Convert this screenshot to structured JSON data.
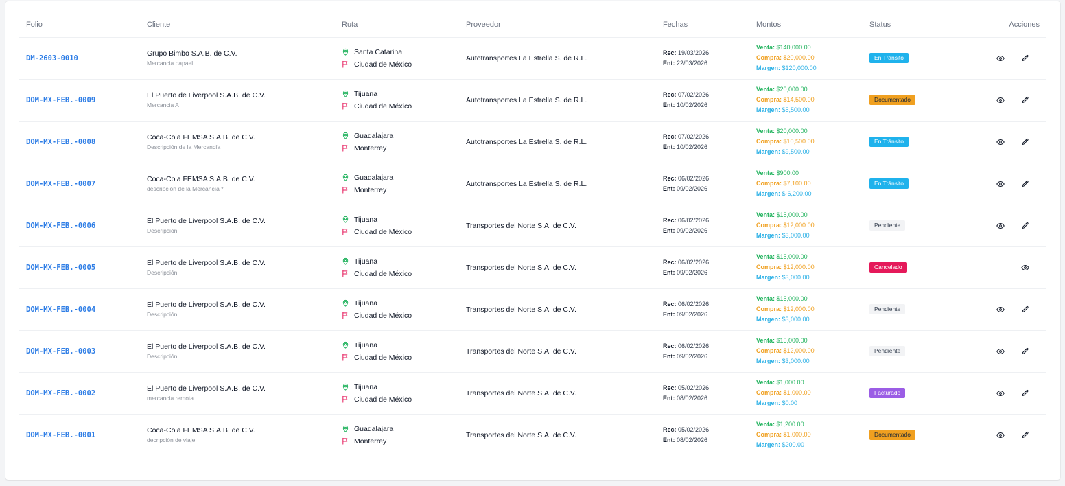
{
  "headers": {
    "folio": "Folio",
    "cliente": "Cliente",
    "ruta": "Ruta",
    "proveedor": "Proveedor",
    "fechas": "Fechas",
    "montos": "Montos",
    "status": "Status",
    "acciones": "Acciones"
  },
  "labels": {
    "rec": "Rec:",
    "ent": "Ent:",
    "venta": "Venta:",
    "compra": "Compra:",
    "margen": "Margen:"
  },
  "colors": {
    "folio_link": "#2f7ee6",
    "venta": "#22b35e",
    "compra": "#f0a020",
    "margen": "#2bb0e6",
    "origin_icon": "#22b35e",
    "destination_icon": "#e5195a"
  },
  "icons": {
    "origin": "map-pin-icon",
    "destination": "flag-icon",
    "view": "eye-icon",
    "edit": "pencil-icon"
  },
  "rows": [
    {
      "folio": "DM-2603-0010",
      "client": "Grupo Bimbo S.A.B. de C.V.",
      "desc": "Mercancia papael",
      "origin": "Santa Catarina",
      "destination": "Ciudad de México",
      "provider": "Autotransportes La Estrella S. de R.L.",
      "rec": "19/03/2026",
      "ent": "22/03/2026",
      "venta": "$140,000.00",
      "compra": "$20,000.00",
      "margen": "$120,000.00",
      "status": "En Tránsito",
      "status_type": "transito",
      "editable": true
    },
    {
      "folio": "DOM-MX-FEB.-0009",
      "client": "El Puerto de Liverpool S.A.B. de C.V.",
      "desc": "Mercancia A",
      "origin": "Tijuana",
      "destination": "Ciudad de México",
      "provider": "Autotransportes La Estrella S. de R.L.",
      "rec": "07/02/2026",
      "ent": "10/02/2026",
      "venta": "$20,000.00",
      "compra": "$14,500.00",
      "margen": "$5,500.00",
      "status": "Documentado",
      "status_type": "documentado",
      "editable": true
    },
    {
      "folio": "DOM-MX-FEB.-0008",
      "client": "Coca-Cola FEMSA S.A.B. de C.V.",
      "desc": "Descripción de la Mercancía",
      "origin": "Guadalajara",
      "destination": "Monterrey",
      "provider": "Autotransportes La Estrella S. de R.L.",
      "rec": "07/02/2026",
      "ent": "10/02/2026",
      "venta": "$20,000.00",
      "compra": "$10,500.00",
      "margen": "$9,500.00",
      "status": "En Tránsito",
      "status_type": "transito",
      "editable": true
    },
    {
      "folio": "DOM-MX-FEB.-0007",
      "client": "Coca-Cola FEMSA S.A.B. de C.V.",
      "desc": "descripción de la Mercancía *",
      "origin": "Guadalajara",
      "destination": "Monterrey",
      "provider": "Autotransportes La Estrella S. de R.L.",
      "rec": "06/02/2026",
      "ent": "09/02/2026",
      "venta": "$900.00",
      "compra": "$7,100.00",
      "margen": "$-6,200.00",
      "status": "En Tránsito",
      "status_type": "transito",
      "editable": true
    },
    {
      "folio": "DOM-MX-FEB.-0006",
      "client": "El Puerto de Liverpool S.A.B. de C.V.",
      "desc": "Descripción",
      "origin": "Tijuana",
      "destination": "Ciudad de México",
      "provider": "Transportes del Norte S.A. de C.V.",
      "rec": "06/02/2026",
      "ent": "09/02/2026",
      "venta": "$15,000.00",
      "compra": "$12,000.00",
      "margen": "$3,000.00",
      "status": "Pendiente",
      "status_type": "pendiente",
      "editable": true
    },
    {
      "folio": "DOM-MX-FEB.-0005",
      "client": "El Puerto de Liverpool S.A.B. de C.V.",
      "desc": "Descripción",
      "origin": "Tijuana",
      "destination": "Ciudad de México",
      "provider": "Transportes del Norte S.A. de C.V.",
      "rec": "06/02/2026",
      "ent": "09/02/2026",
      "venta": "$15,000.00",
      "compra": "$12,000.00",
      "margen": "$3,000.00",
      "status": "Cancelado",
      "status_type": "cancelado",
      "editable": false
    },
    {
      "folio": "DOM-MX-FEB.-0004",
      "client": "El Puerto de Liverpool S.A.B. de C.V.",
      "desc": "Descripción",
      "origin": "Tijuana",
      "destination": "Ciudad de México",
      "provider": "Transportes del Norte S.A. de C.V.",
      "rec": "06/02/2026",
      "ent": "09/02/2026",
      "venta": "$15,000.00",
      "compra": "$12,000.00",
      "margen": "$3,000.00",
      "status": "Pendiente",
      "status_type": "pendiente",
      "editable": true
    },
    {
      "folio": "DOM-MX-FEB.-0003",
      "client": "El Puerto de Liverpool S.A.B. de C.V.",
      "desc": "Descripción",
      "origin": "Tijuana",
      "destination": "Ciudad de México",
      "provider": "Transportes del Norte S.A. de C.V.",
      "rec": "06/02/2026",
      "ent": "09/02/2026",
      "venta": "$15,000.00",
      "compra": "$12,000.00",
      "margen": "$3,000.00",
      "status": "Pendiente",
      "status_type": "pendiente",
      "editable": true
    },
    {
      "folio": "DOM-MX-FEB.-0002",
      "client": "El Puerto de Liverpool S.A.B. de C.V.",
      "desc": "mercancia remota",
      "origin": "Tijuana",
      "destination": "Ciudad de México",
      "provider": "Transportes del Norte S.A. de C.V.",
      "rec": "05/02/2026",
      "ent": "08/02/2026",
      "venta": "$1,000.00",
      "compra": "$1,000.00",
      "margen": "$0.00",
      "status": "Facturado",
      "status_type": "facturado",
      "editable": true
    },
    {
      "folio": "DOM-MX-FEB.-0001",
      "client": "Coca-Cola FEMSA S.A.B. de C.V.",
      "desc": "decripción de viaje",
      "origin": "Guadalajara",
      "destination": "Monterrey",
      "provider": "Transportes del Norte S.A. de C.V.",
      "rec": "05/02/2026",
      "ent": "08/02/2026",
      "venta": "$1,200.00",
      "compra": "$1,000.00",
      "margen": "$200.00",
      "status": "Documentado",
      "status_type": "documentado",
      "editable": true
    }
  ]
}
